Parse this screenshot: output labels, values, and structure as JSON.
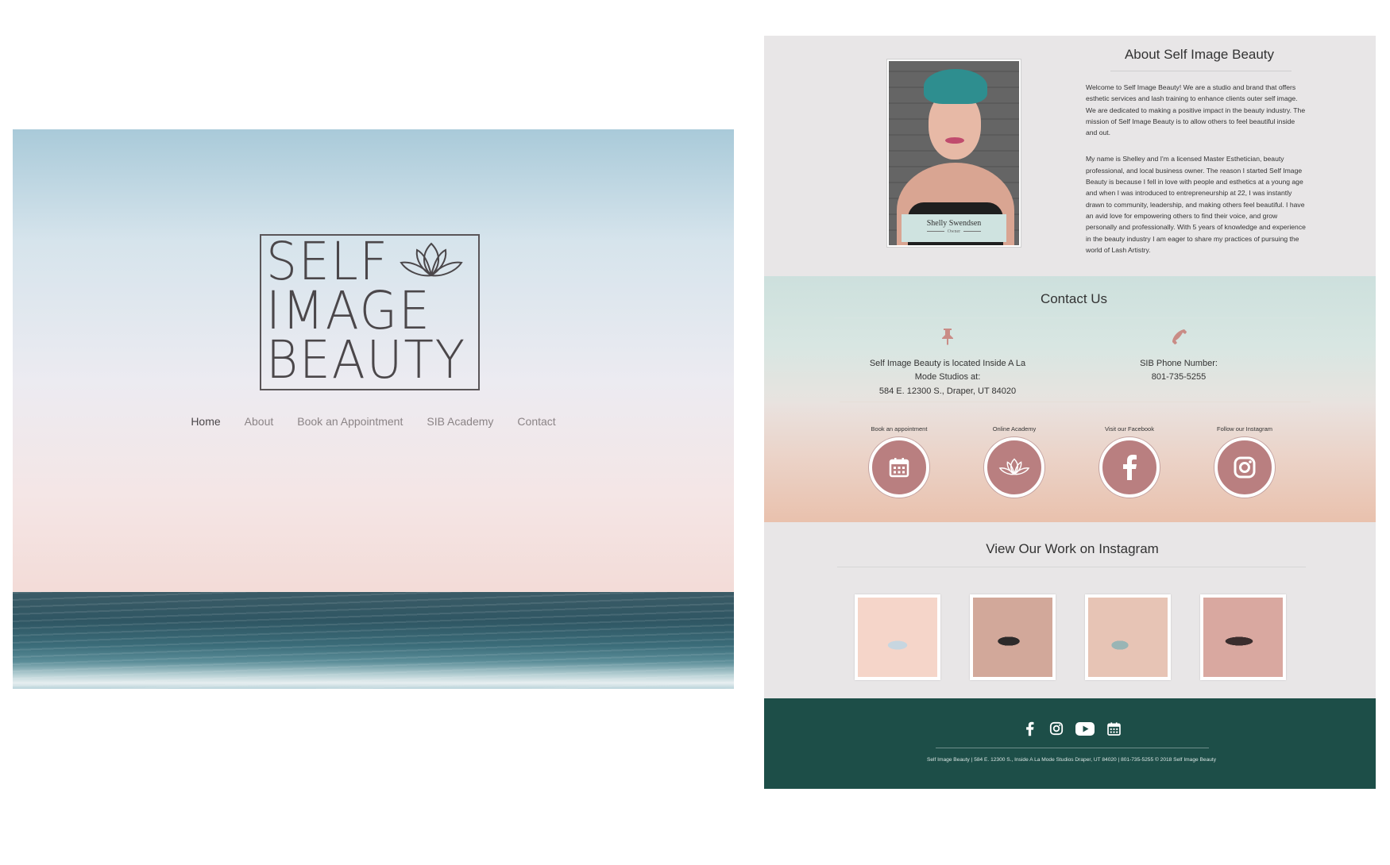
{
  "hero": {
    "logo_lines": [
      "SELF",
      "IMAGE",
      "BEAUTY"
    ],
    "nav": [
      "Home",
      "About",
      "Book an Appointment",
      "SIB Academy",
      "Contact"
    ],
    "active_nav": "Home"
  },
  "about": {
    "title": "About Self Image Beauty",
    "portrait": {
      "name": "Shelly Swendsen",
      "role": "Owner"
    },
    "paragraphs": [
      "Welcome to Self Image Beauty! We are a studio and brand that offers esthetic services and lash training to enhance clients outer self image. We are dedicated to making a positive impact in the beauty industry. The mission of Self Image Beauty is to allow others to feel beautiful inside and out.",
      "My name is Shelley and I'm a licensed Master Esthetician, beauty professional, and local business owner. The reason I started Self Image Beauty is because I fell in love with people and esthetics at a young age and when I was introduced to entrepreneurship at 22, I was instantly drawn to community, leadership, and making others feel beautiful. I have an avid love for empowering others to find their voice, and grow personally and professionally. With 5 years of knowledge and experience in the beauty industry I am eager to share my practices of pursuing the world of Lash Artistry."
    ]
  },
  "contact": {
    "title": "Contact Us",
    "location_line1": "Self Image Beauty is located Inside A La Mode Studios at:",
    "location_line2": "584 E. 12300 S., Draper, UT 84020",
    "phone_label": "SIB Phone Number:",
    "phone_number": "801-735-5255"
  },
  "links": [
    {
      "label": "Book an appointment",
      "icon": "calendar-icon"
    },
    {
      "label": "Online Academy",
      "icon": "lotus-icon"
    },
    {
      "label": "Visit our Facebook",
      "icon": "facebook-icon"
    },
    {
      "label": "Follow our Instagram",
      "icon": "instagram-icon"
    }
  ],
  "instagram": {
    "title": "View Our Work on Instagram"
  },
  "footer": {
    "icons": [
      "facebook-icon",
      "instagram-icon",
      "youtube-icon",
      "calendar-icon"
    ],
    "text": "Self Image Beauty | 584 E. 12300 S., Inside A La Mode Studios Draper, UT 84020 | 801-735-5255 © 2018 Self Image Beauty"
  },
  "colors": {
    "accent_rose": "#b97f80",
    "footer_green": "#1d4e48",
    "mint": "#cde0dd",
    "peach": "#e9c1ad"
  }
}
